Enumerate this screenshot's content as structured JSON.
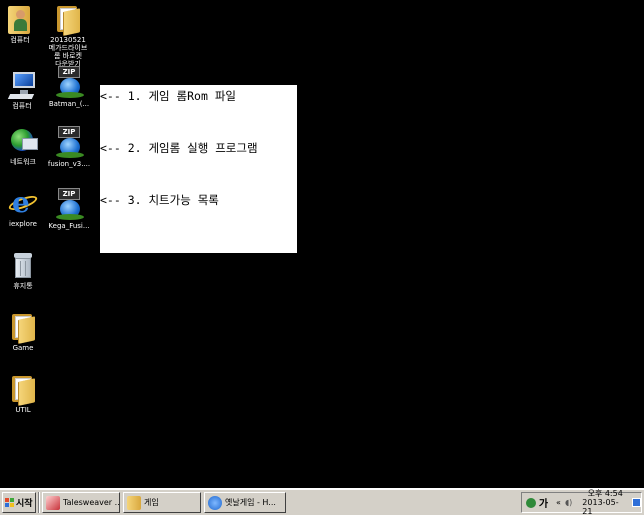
{
  "desktop": {
    "icons": [
      {
        "name": "user-folder-icon",
        "label": "컴퓨터"
      },
      {
        "name": "folder-icon",
        "label": "20130521\n메가드라이브\n롬 바로켓\n다운받기"
      },
      {
        "name": "computer-icon",
        "label": "컴퓨터"
      },
      {
        "name": "zip-icon",
        "label": "Batman_(..."
      },
      {
        "name": "network-icon",
        "label": "네트워크"
      },
      {
        "name": "zip-icon",
        "label": "fusion_v3...."
      },
      {
        "name": "ie-icon",
        "label": "iexplore"
      },
      {
        "name": "zip-icon",
        "label": "Kega_Fusi..."
      },
      {
        "name": "recycle-bin-icon",
        "label": "휴지통"
      },
      {
        "name": "folder-icon",
        "label": "Game"
      },
      {
        "name": "folder-icon",
        "label": "UTIL"
      }
    ]
  },
  "callout": {
    "line1": "<-- 1. 게임 롬Rom 파일",
    "line2": "<-- 2. 게임롬 실행 프로그램",
    "line3": "<-- 3. 치트가능 목록"
  },
  "taskbar": {
    "start_label": "시작",
    "tasks": [
      {
        "label": "Talesweaver ..."
      },
      {
        "label": "게임"
      },
      {
        "label": "옛날게임 - H..."
      }
    ],
    "tray": {
      "ime": "가",
      "time_prefix": "오후 4:54",
      "date": "2013-05-21"
    }
  },
  "colors": {
    "desktop_bg": "#000000",
    "taskbar_bg": "#d4d0c8",
    "callout_bg": "#ffffff"
  }
}
